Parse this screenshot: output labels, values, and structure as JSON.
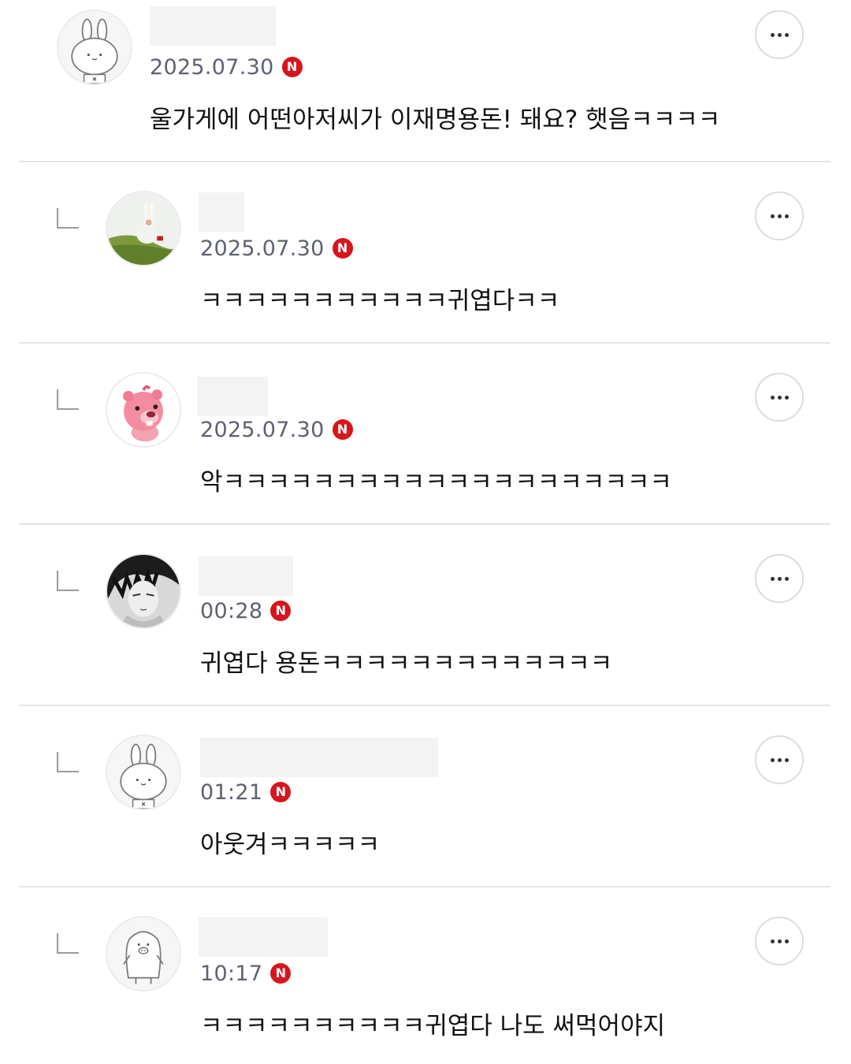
{
  "comments": [
    {
      "date": "2025.07.30",
      "badge": "N",
      "text": "울가게에 어떤아저씨가 이재명용돈! 돼요? 햇음ㅋㅋㅋㅋ",
      "avatar": "bunny-outline-avatar",
      "reply": false
    },
    {
      "date": "2025.07.30",
      "badge": "N",
      "text": "ㅋㅋㅋㅋㅋㅋㅋㅋㅋㅋㅋ귀엽다ㅋㅋ",
      "avatar": "bunny-costume-photo-avatar",
      "reply": true
    },
    {
      "date": "2025.07.30",
      "badge": "N",
      "text": "악ㅋㅋㅋㅋㅋㅋㅋㅋㅋㅋㅋㅋㅋㅋㅋㅋㅋㅋㅋㅋ",
      "avatar": "pink-beaver-avatar",
      "reply": true
    },
    {
      "date": "00:28",
      "badge": "N",
      "text": "귀엽다 용돈ㅋㅋㅋㅋㅋㅋㅋㅋㅋㅋㅋㅋㅋ",
      "avatar": "manga-man-avatar",
      "reply": true
    },
    {
      "date": "01:21",
      "badge": "N",
      "text": "아웃겨ㅋㅋㅋㅋㅋ",
      "avatar": "bunny-outline-avatar",
      "reply": true
    },
    {
      "date": "10:17",
      "badge": "N",
      "text": "ㅋㅋㅋㅋㅋㅋㅋㅋㅋㅋ귀엽다 나도 써먹어야지",
      "avatar": "penguin-outline-avatar",
      "reply": true
    }
  ],
  "colors": {
    "badge": "#d8141c",
    "date": "#5e6170",
    "divider": "#e4e4e6"
  }
}
